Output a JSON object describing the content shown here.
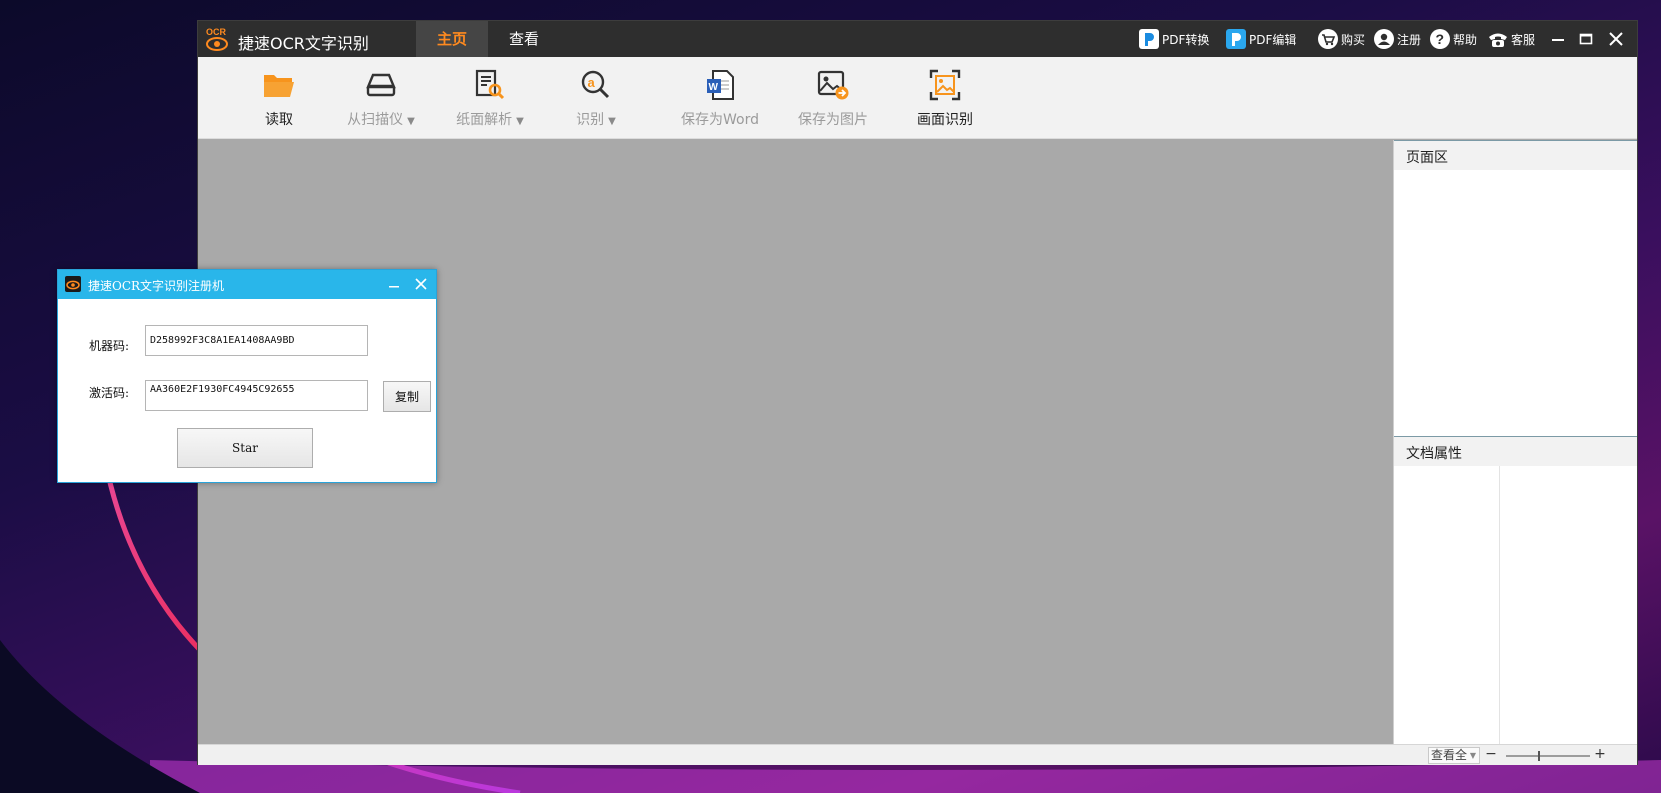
{
  "main_window": {
    "title": "捷速OCR文字识别",
    "logo_text": "OCR",
    "tabs": [
      "主页",
      "查看"
    ],
    "top_links": {
      "pdf_convert": "PDF转换",
      "pdf_edit": "PDF编辑",
      "buy": "购买",
      "register": "注册",
      "help": "帮助",
      "service": "客服"
    },
    "toolbar": {
      "read": "读取",
      "scanner": "从扫描仪",
      "page_parse": "纸面解析",
      "recognize": "识别",
      "save_word": "保存为Word",
      "save_image": "保存为图片",
      "screen_ocr": "画面识别"
    },
    "right_panel": {
      "page_area": "页面区",
      "doc_props": "文档属性"
    },
    "statusbar": {
      "zoom_mode": "查看全",
      "zoom_level": 0.38
    }
  },
  "dialog": {
    "title": "捷速OCR文字识别注册机",
    "machine_code_label": "机器码:",
    "machine_code": "D258992F3C8A1EA1408AA9BD",
    "activation_label": "激活码:",
    "activation_code": "AA360E2F1930FC4945C92655",
    "copy_button": "复制",
    "start_button": "Star"
  },
  "colors": {
    "accent_orange": "#ff8a1f",
    "titlebar_dark": "#2e2e2e",
    "dialog_blue": "#29b6ea",
    "canvas_gray": "#a9a9a9"
  }
}
